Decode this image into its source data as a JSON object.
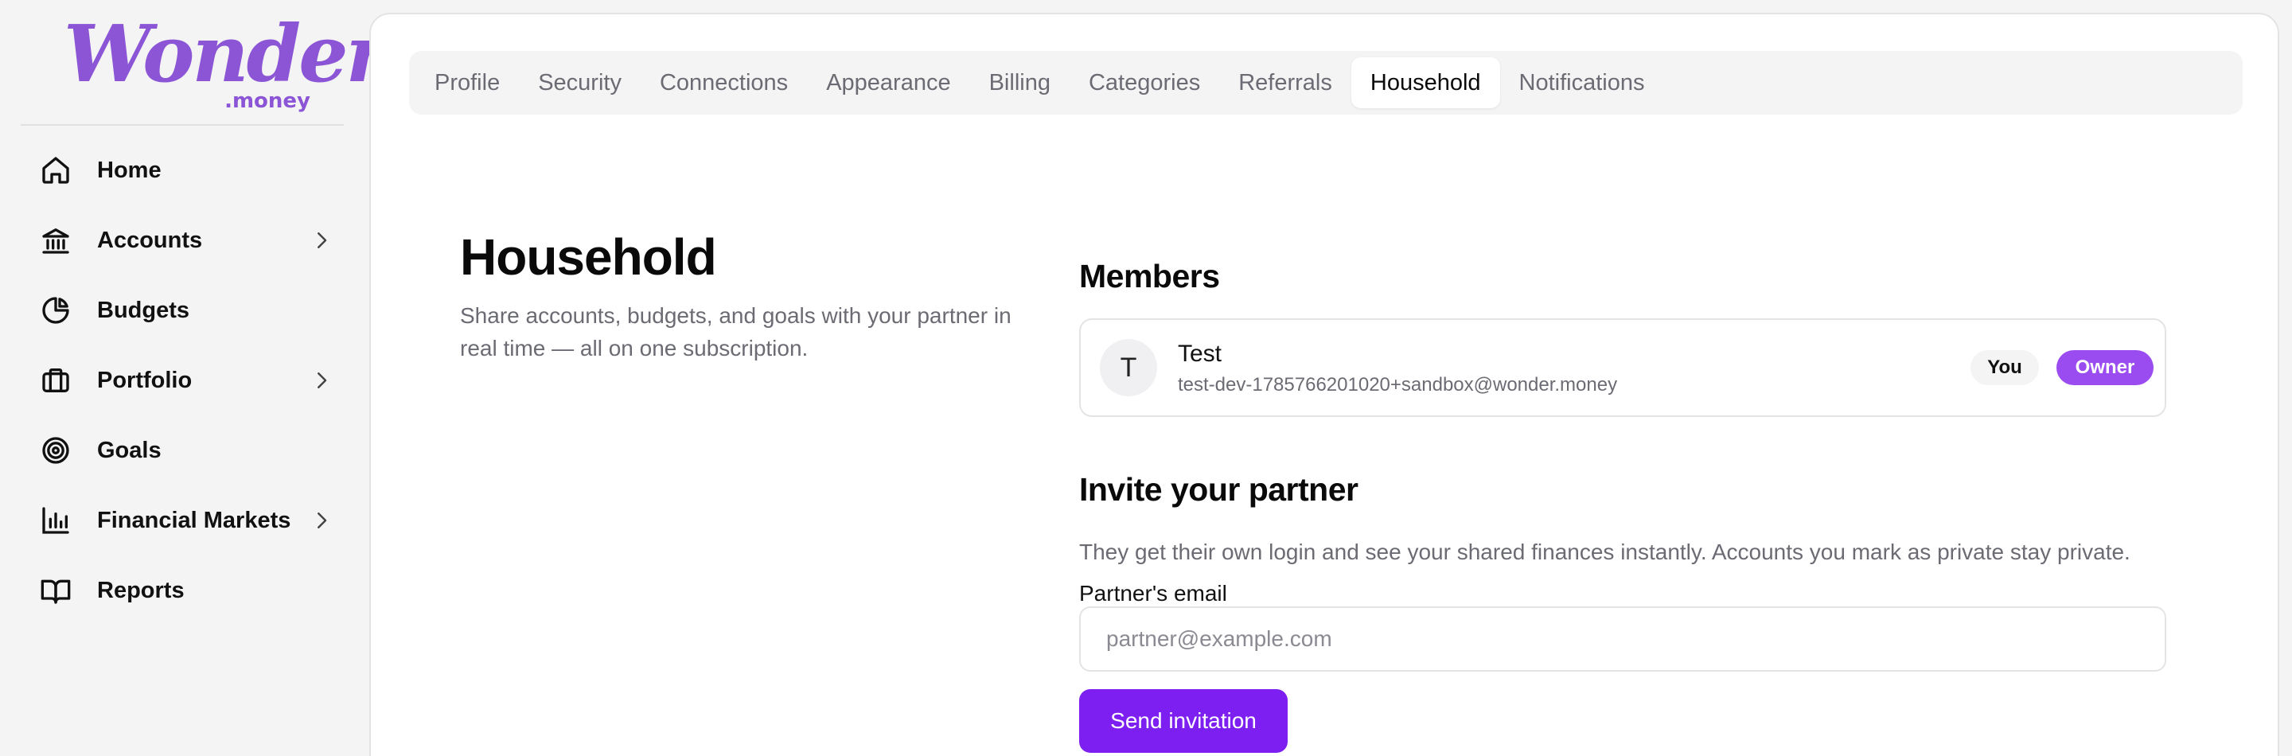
{
  "brand": {
    "logo_word": "Wonder",
    "logo_suffix": ".money",
    "color": "#8b55d6"
  },
  "sidebar": {
    "items": [
      {
        "label": "Home",
        "icon": "home-icon",
        "has_chevron": false
      },
      {
        "label": "Accounts",
        "icon": "bank-icon",
        "has_chevron": true
      },
      {
        "label": "Budgets",
        "icon": "pie-chart-icon",
        "has_chevron": false
      },
      {
        "label": "Portfolio",
        "icon": "briefcase-icon",
        "has_chevron": true
      },
      {
        "label": "Goals",
        "icon": "target-icon",
        "has_chevron": false
      },
      {
        "label": "Financial Markets",
        "icon": "bar-chart-icon",
        "has_chevron": true
      },
      {
        "label": "Reports",
        "icon": "book-icon",
        "has_chevron": false
      }
    ]
  },
  "tabs": [
    {
      "label": "Profile",
      "active": false
    },
    {
      "label": "Security",
      "active": false
    },
    {
      "label": "Connections",
      "active": false
    },
    {
      "label": "Appearance",
      "active": false
    },
    {
      "label": "Billing",
      "active": false
    },
    {
      "label": "Categories",
      "active": false
    },
    {
      "label": "Referrals",
      "active": false
    },
    {
      "label": "Household",
      "active": true
    },
    {
      "label": "Notifications",
      "active": false
    }
  ],
  "intro": {
    "title": "Household",
    "description": "Share accounts, budgets, and goals with your partner in real time — all on one subscription."
  },
  "members": {
    "title": "Members",
    "list": [
      {
        "initial": "T",
        "name": "Test",
        "email": "test-dev-1785766201020+sandbox@wonder.money",
        "badge_you": "You",
        "badge_role": "Owner"
      }
    ]
  },
  "invite": {
    "title": "Invite your partner",
    "description": "They get their own login and see your shared finances instantly. Accounts you mark as private stay private.",
    "email_label": "Partner's email",
    "email_placeholder": "partner@example.com",
    "email_value": "",
    "submit_label": "Send invitation"
  },
  "colors": {
    "accent": "#7c1ff0",
    "owner_badge": "#9b4cf0",
    "muted_text": "#6b6b73"
  }
}
